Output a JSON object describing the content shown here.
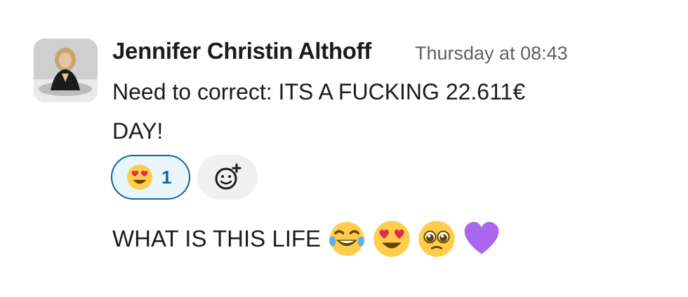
{
  "message": {
    "author": "Jennifer Christin Althoff",
    "timestamp": "Thursday at 08:43",
    "text_line1": "Need to correct: ITS A FUCKING 22.611€",
    "text_line2": "DAY!",
    "reactions": [
      {
        "icon": "heart-eyes-emoji",
        "count": "1"
      }
    ],
    "add_reaction_icon": "add-reaction-icon",
    "second_message": {
      "text": "WHAT IS THIS LIFE",
      "emojis": [
        "tears-of-joy-emoji",
        "heart-eyes-emoji",
        "pleading-face-emoji",
        "purple-heart-emoji"
      ]
    }
  },
  "colors": {
    "accent": "#1264a3",
    "reaction_bg": "#e8f5fa",
    "timestamp": "#616061"
  }
}
